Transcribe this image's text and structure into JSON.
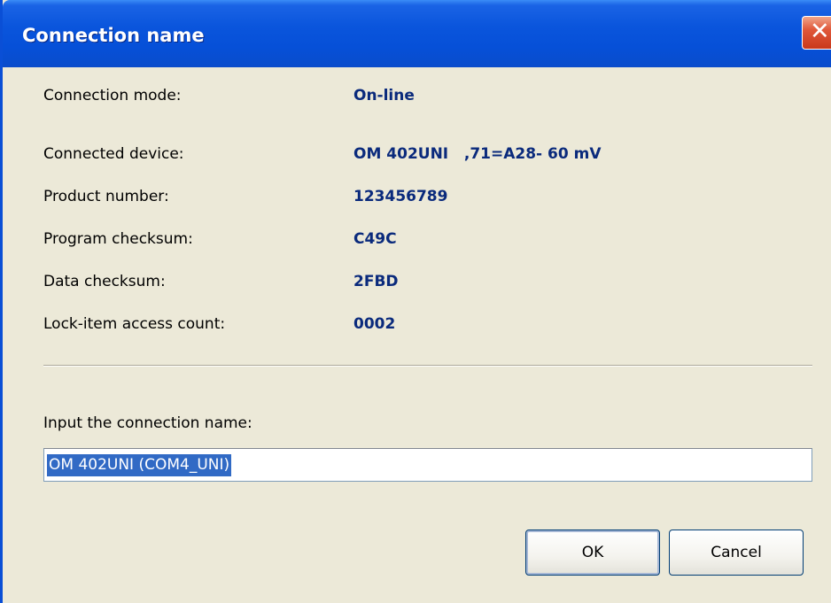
{
  "window": {
    "title": "Connection name",
    "close_glyph": "✕"
  },
  "info_rows": [
    {
      "label": "Connection mode:",
      "value": "On-line"
    },
    {
      "label": "Connected device:",
      "value": "OM 402UNI   ,71=A28- 60 mV"
    },
    {
      "label": "Product number:",
      "value": "123456789"
    },
    {
      "label": "Program checksum:",
      "value": "C49C"
    },
    {
      "label": "Data checksum:",
      "value": "2FBD"
    },
    {
      "label": "Lock-item access count:",
      "value": "0002"
    }
  ],
  "form": {
    "prompt": "Input the connection name:",
    "name_value": "OM 402UNI (COM4_UNI)"
  },
  "buttons": {
    "ok": "OK",
    "cancel": "Cancel"
  },
  "colors": {
    "titlebar": "#0a55dc",
    "value_text": "#0a2a7c",
    "selection": "#316ac5",
    "background": "#ece9d8"
  }
}
